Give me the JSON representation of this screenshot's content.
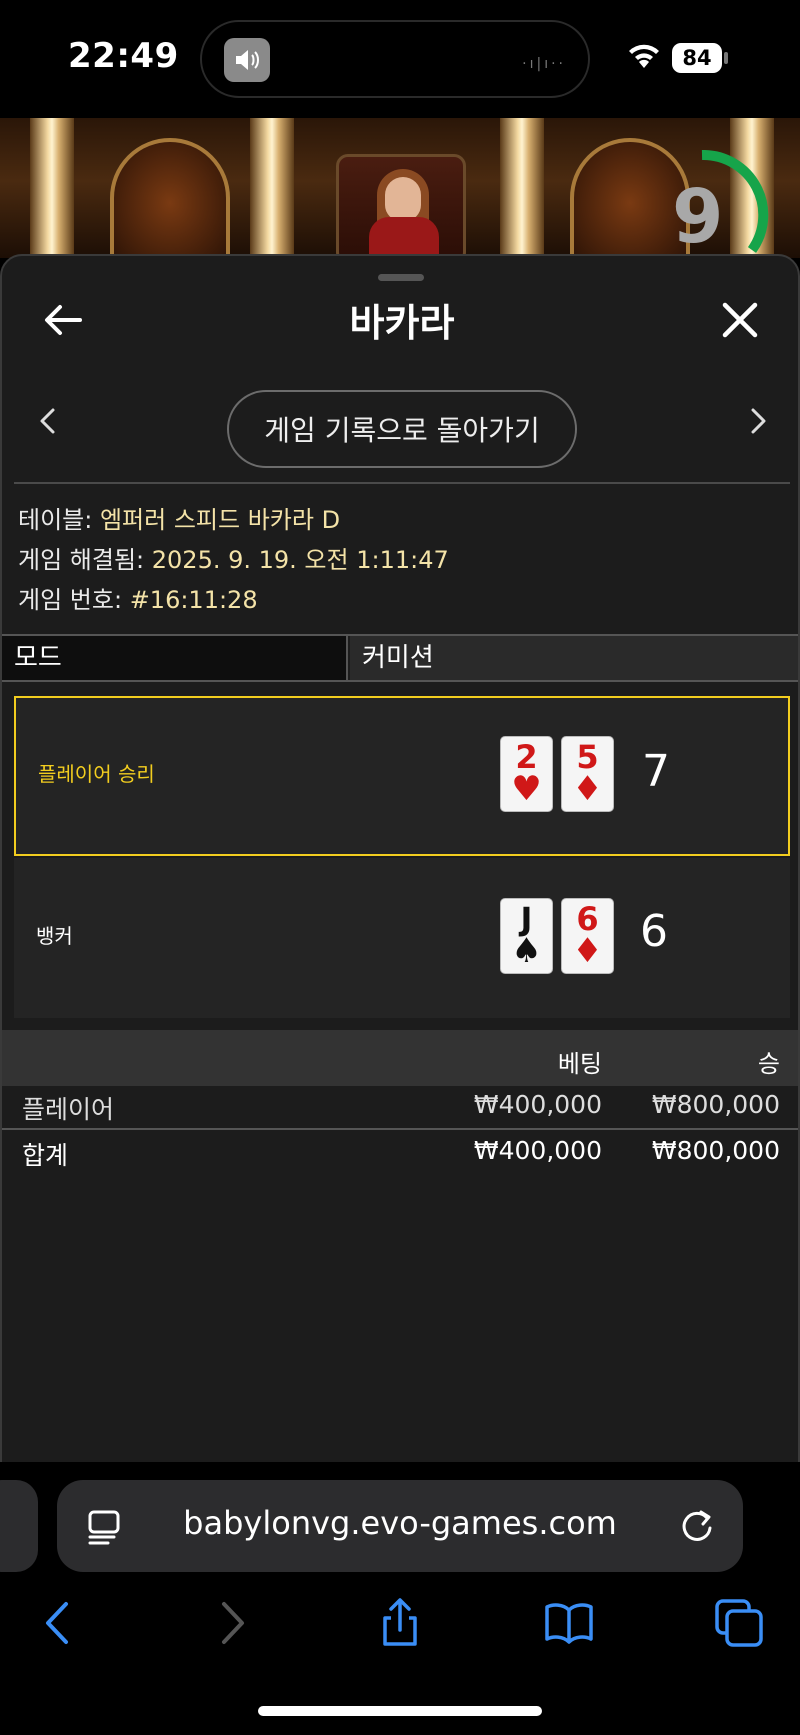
{
  "status_bar": {
    "time": "22:49",
    "battery": "84",
    "icons": [
      "speaker-icon",
      "wifi-icon",
      "battery-icon"
    ]
  },
  "live_view": {
    "countdown": "9"
  },
  "sheet": {
    "title": "바카라",
    "history_button": "게임 기록으로 돌아가기",
    "info": {
      "table_label": "테이블:",
      "table_value": "엠퍼러 스피드 바카라 D",
      "resolved_label": "게임 해결됨:",
      "resolved_value": "2025. 9. 19. 오전 1:11:47",
      "number_label": "게임 번호:",
      "number_value": "#16:11:28"
    },
    "mode": {
      "label": "모드",
      "value": "커미션"
    },
    "results": [
      {
        "label": "플레이어 승리",
        "winner": true,
        "cards": [
          {
            "rank": "2",
            "suit": "♥",
            "color": "red"
          },
          {
            "rank": "5",
            "suit": "♦",
            "color": "red"
          }
        ],
        "score": "7"
      },
      {
        "label": "뱅커",
        "winner": false,
        "cards": [
          {
            "rank": "J",
            "suit": "♠",
            "color": "black"
          },
          {
            "rank": "6",
            "suit": "♦",
            "color": "red"
          }
        ],
        "score": "6"
      }
    ],
    "bets": {
      "header_bet": "베팅",
      "header_win": "승",
      "rows": [
        {
          "name": "플레이어",
          "bet": "₩400,000",
          "win": "₩800,000"
        }
      ],
      "total": {
        "name": "합계",
        "bet": "₩400,000",
        "win": "₩800,000"
      }
    }
  },
  "browser": {
    "url": "babylonvg.evo-games.com",
    "toolbar_icons": [
      "back-icon",
      "forward-icon",
      "share-icon",
      "bookmarks-icon",
      "tabs-icon"
    ]
  },
  "colors": {
    "win_accent": "#f2cd1f",
    "info_value": "#f4e3a8",
    "safari_blue": "#3a8ef6",
    "timer_green": "#16a44a"
  }
}
